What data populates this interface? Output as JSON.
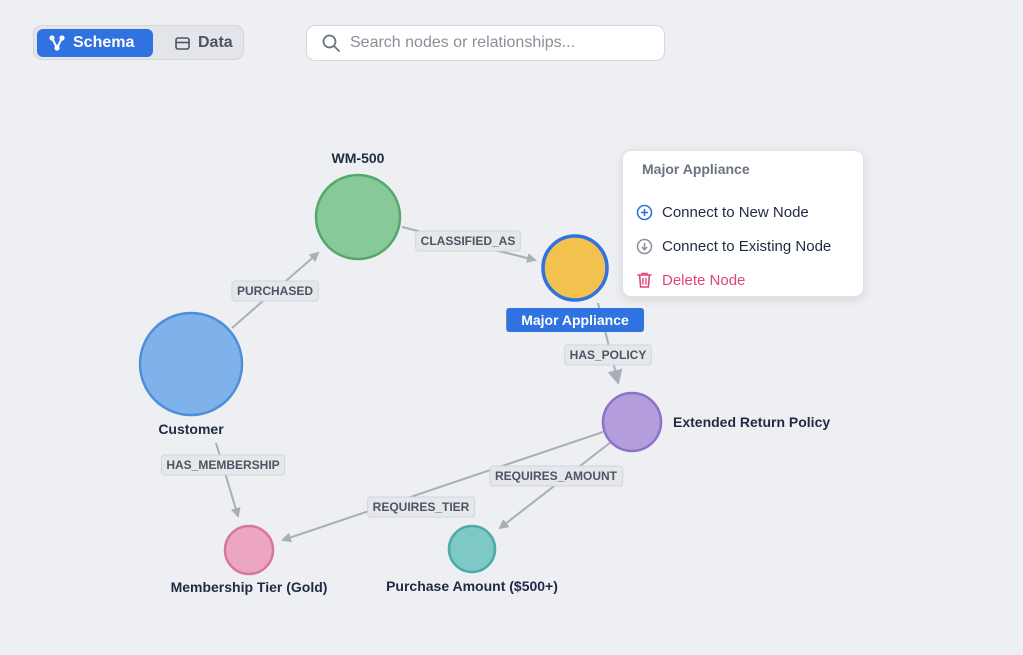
{
  "toolbar": {
    "schema_label": "Schema",
    "data_label": "Data",
    "active_view": "Schema"
  },
  "search": {
    "placeholder": "Search nodes or relationships..."
  },
  "colors": {
    "accent": "#2f72e0",
    "danger": "#e0457b",
    "edge": "#a9aeb7"
  },
  "chart_data": {
    "type": "graph",
    "nodes": [
      {
        "id": "customer",
        "label": "Customer",
        "color": "#7fb2ea",
        "stroke": "#4f8fd9"
      },
      {
        "id": "wm500",
        "label": "WM-500",
        "color": "#88c99a",
        "stroke": "#55a86c"
      },
      {
        "id": "major",
        "label": "Major Appliance",
        "color": "#f2c14e",
        "stroke": "#2f72e0",
        "selected": true
      },
      {
        "id": "policy",
        "label": "Extended Return Policy",
        "color": "#b39ddd",
        "stroke": "#8e72c9"
      },
      {
        "id": "tier",
        "label": "Membership Tier (Gold)",
        "color": "#eca6c2",
        "stroke": "#d7769d"
      },
      {
        "id": "amount",
        "label": "Purchase Amount ($500+)",
        "color": "#7fc8c8",
        "stroke": "#4ea9a9"
      }
    ],
    "edges": [
      {
        "source": "customer",
        "target": "wm500",
        "label": "PURCHASED"
      },
      {
        "source": "wm500",
        "target": "major",
        "label": "CLASSIFIED_AS"
      },
      {
        "source": "major",
        "target": "policy",
        "label": "HAS_POLICY"
      },
      {
        "source": "customer",
        "target": "tier",
        "label": "HAS_MEMBERSHIP"
      },
      {
        "source": "policy",
        "target": "tier",
        "label": "REQUIRES_TIER"
      },
      {
        "source": "policy",
        "target": "amount",
        "label": "REQUIRES_AMOUNT"
      }
    ]
  },
  "context_menu": {
    "title": "Major Appliance",
    "items": [
      {
        "label": "Connect to New Node",
        "icon": "plus-circle-icon"
      },
      {
        "label": "Connect to Existing Node",
        "icon": "arrow-down-circle-icon"
      },
      {
        "label": "Delete Node",
        "icon": "trash-icon"
      }
    ]
  }
}
